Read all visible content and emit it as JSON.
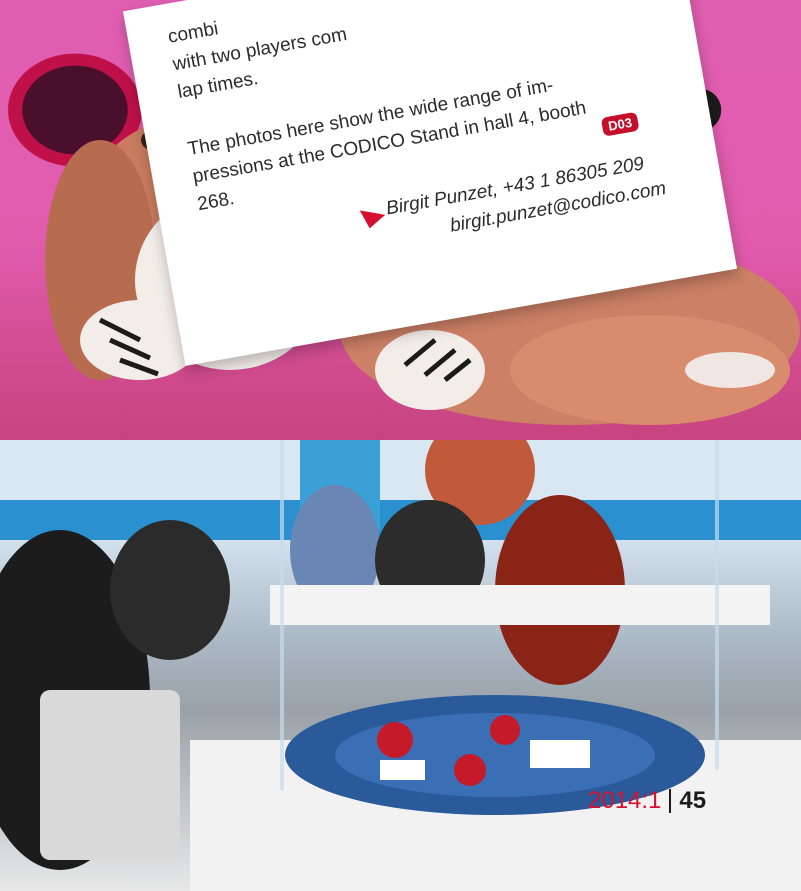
{
  "card": {
    "line1": "combi",
    "line2": "with two players com",
    "line3": "lap times.",
    "para_a": "The photos here show the wide range of im-",
    "para_b": "pressions at the CODICO Stand in hall 4, booth",
    "para_c": "268.",
    "badge": "D03",
    "signature_name": "Birgit Punzet, +43 1 86305 209",
    "signature_email": "birgit.punzet@codico.com"
  },
  "folio": {
    "issue": "2014:1",
    "page": "45"
  },
  "colors": {
    "accent_red": "#d6112f",
    "pink_background": "#e24ea0",
    "text_dark": "#2b2b2b"
  }
}
